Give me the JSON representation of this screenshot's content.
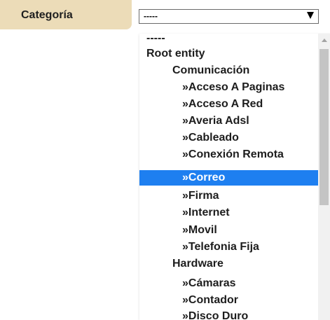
{
  "field": {
    "label": "Categoría"
  },
  "select": {
    "value": "-----"
  },
  "dropdown": {
    "options": [
      "-----",
      "Root entity",
      "Comunicación",
      "»Acceso A Paginas",
      "»Acceso A Red",
      "»Averia Adsl",
      "»Cableado",
      "»Conexión Remota",
      "»Correo",
      "»Firma",
      "»Internet",
      "»Movil",
      "»Telefonia Fija",
      "Hardware",
      "»Cámaras",
      "»Contador",
      "»Disco Duro"
    ],
    "highlighted_option": "»Correo"
  },
  "colors": {
    "label_background": "#ecdcb8",
    "highlight": "#1e7ff0",
    "scrollbar_track": "#f1f1f1",
    "scrollbar_thumb": "#c4c4c4"
  }
}
